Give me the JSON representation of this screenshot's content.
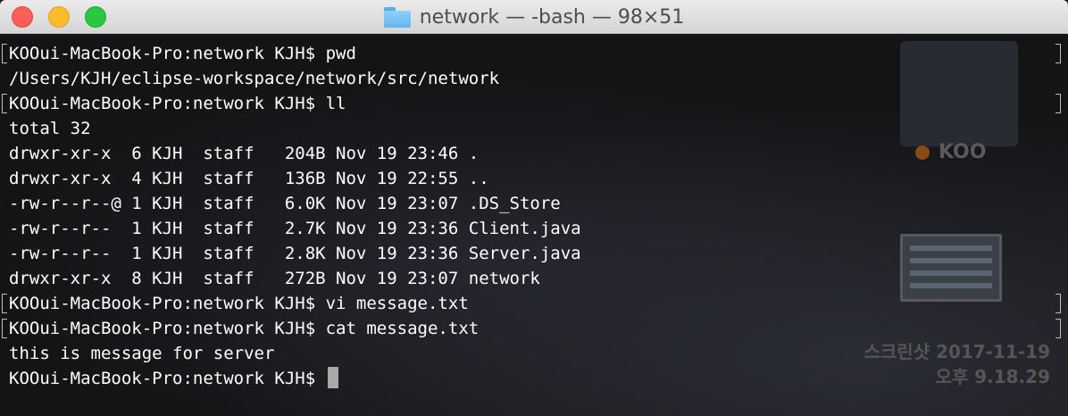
{
  "window": {
    "title": "network — -bash — 98×51",
    "folder_icon": "folder-icon"
  },
  "desktop": {
    "koo_label": "KOO",
    "screenshot_caption_line1": "스크린샷 2017-11-19",
    "screenshot_caption_line2": "오후 9.18.29"
  },
  "terminal": {
    "lines": [
      {
        "text": "KOOui-MacBook-Pro:network KJH$ pwd",
        "marked": true
      },
      {
        "text": "/Users/KJH/eclipse-workspace/network/src/network",
        "marked": false
      },
      {
        "text": "KOOui-MacBook-Pro:network KJH$ ll",
        "marked": true
      },
      {
        "text": "total 32",
        "marked": false
      },
      {
        "text": "drwxr-xr-x  6 KJH  staff   204B Nov 19 23:46 .",
        "marked": false
      },
      {
        "text": "drwxr-xr-x  4 KJH  staff   136B Nov 19 22:55 ..",
        "marked": false
      },
      {
        "text": "-rw-r--r--@ 1 KJH  staff   6.0K Nov 19 23:07 .DS_Store",
        "marked": false
      },
      {
        "text": "-rw-r--r--  1 KJH  staff   2.7K Nov 19 23:36 Client.java",
        "marked": false
      },
      {
        "text": "-rw-r--r--  1 KJH  staff   2.8K Nov 19 23:36 Server.java",
        "marked": false
      },
      {
        "text": "drwxr-xr-x  8 KJH  staff   272B Nov 19 23:07 network",
        "marked": false
      },
      {
        "text": "KOOui-MacBook-Pro:network KJH$ vi message.txt",
        "marked": true
      },
      {
        "text": "KOOui-MacBook-Pro:network KJH$ cat message.txt",
        "marked": true
      },
      {
        "text": "this is message for server",
        "marked": false
      }
    ],
    "prompt": "KOOui-MacBook-Pro:network KJH$ "
  },
  "colors": {
    "close": "#fc5f57",
    "minimize": "#fdbc2e",
    "zoom": "#28c840",
    "terminal_bg": "#141416",
    "text": "#ffffff"
  }
}
